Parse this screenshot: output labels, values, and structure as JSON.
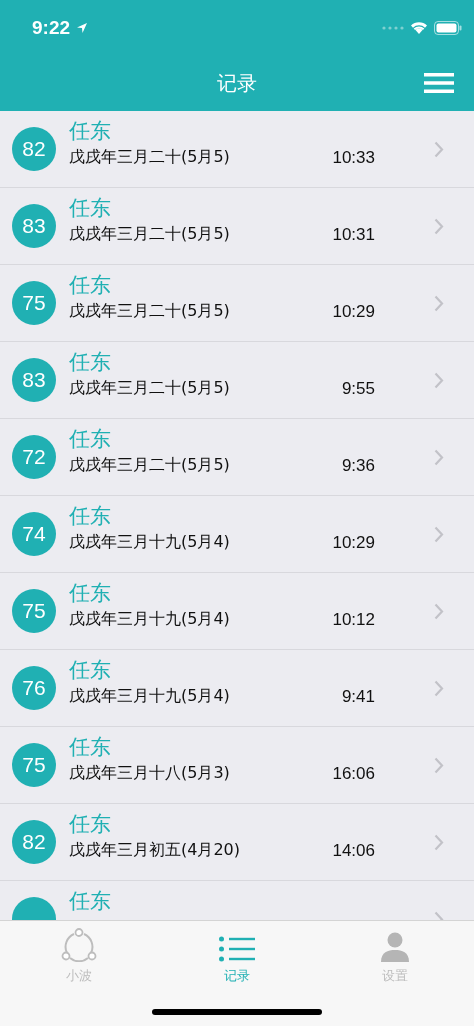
{
  "status_bar": {
    "time": "9:22"
  },
  "nav": {
    "title": "记录"
  },
  "records": [
    {
      "score": "82",
      "name": "任东",
      "date": "戊戌年三月二十(5月5)",
      "time": "10:33"
    },
    {
      "score": "83",
      "name": "任东",
      "date": "戊戌年三月二十(5月5)",
      "time": "10:31"
    },
    {
      "score": "75",
      "name": "任东",
      "date": "戊戌年三月二十(5月5)",
      "time": "10:29"
    },
    {
      "score": "83",
      "name": "任东",
      "date": "戊戌年三月二十(5月5)",
      "time": "9:55"
    },
    {
      "score": "72",
      "name": "任东",
      "date": "戊戌年三月二十(5月5)",
      "time": "9:36"
    },
    {
      "score": "74",
      "name": "任东",
      "date": "戊戌年三月十九(5月4)",
      "time": "10:29"
    },
    {
      "score": "75",
      "name": "任东",
      "date": "戊戌年三月十九(5月4)",
      "time": "10:12"
    },
    {
      "score": "76",
      "name": "任东",
      "date": "戊戌年三月十九(5月4)",
      "time": "9:41"
    },
    {
      "score": "75",
      "name": "任东",
      "date": "戊戌年三月十八(5月3)",
      "time": "16:06"
    },
    {
      "score": "82",
      "name": "任东",
      "date": "戊戌年三月初五(4月20)",
      "time": "14:06"
    },
    {
      "name": "任东"
    }
  ],
  "tabs": [
    {
      "kind": "wave",
      "label": "小波",
      "selected": false
    },
    {
      "kind": "list",
      "label": "记录",
      "selected": true
    },
    {
      "kind": "user",
      "label": "设置",
      "selected": false
    }
  ]
}
